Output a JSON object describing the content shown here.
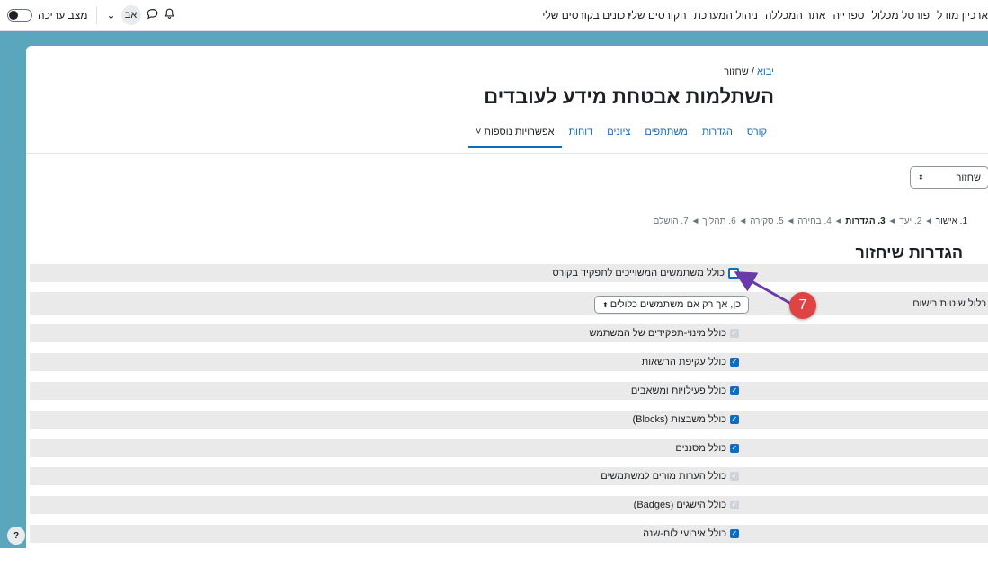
{
  "topbar": {
    "nav": [
      "רכונים בקורסים שלי",
      "הקורסים שלי",
      "ניהול המערכת",
      "אתר המכללה",
      "ספרייה",
      "פורטל מכלול",
      "ארכיון מודל"
    ],
    "edit_mode_label": "מצב עריכה",
    "user_initials": "אב"
  },
  "breadcrumb": {
    "home": "יבוא",
    "sep": "/",
    "current": "שחזור"
  },
  "page_title": "השתלמות אבטחת מידע לעובדים",
  "secondary_nav": [
    {
      "label": "קורס",
      "active": false
    },
    {
      "label": "הגדרות",
      "active": false
    },
    {
      "label": "משתתפים",
      "active": false
    },
    {
      "label": "ציונים",
      "active": false
    },
    {
      "label": "דוחות",
      "active": false
    },
    {
      "label": "אפשרויות נוספות ˅",
      "active": true
    }
  ],
  "restore_select": {
    "value": "שחזור"
  },
  "steps": {
    "s1": "1. אישור",
    "s2": "2. יעד",
    "s3": "3. הגדרות",
    "s4": "4. בחירה",
    "s5": "5. סקירה",
    "s6": "6. תהליך",
    "s7": "7. הושלם",
    "arrow": "◄"
  },
  "section_title": "הגדרות שיחזור",
  "enrol_methods": {
    "label": "כלול שיטות רישום",
    "value": "כן, אך רק אם משתמשים כלולים"
  },
  "settings": [
    {
      "label": "כולל משתמשים המשוייכים לתפקיד בקורס",
      "state": "empty",
      "shade": true
    },
    {
      "label": "כולל מינוי-תפקידים של המשתמש",
      "state": "disabled",
      "shade": true
    },
    {
      "label": "כולל עקיפת הרשאות",
      "state": "checked",
      "shade": true
    },
    {
      "label": "כולל פעילויות ומשאבים",
      "state": "checked",
      "shade": true
    },
    {
      "label": "כולל משבצות (Blocks)",
      "state": "checked",
      "shade": true
    },
    {
      "label": "כולל מסננים",
      "state": "checked",
      "shade": true
    },
    {
      "label": "כולל הערות מורים למשתמשים",
      "state": "disabled",
      "shade": true
    },
    {
      "label": "כולל הישגים (Badges)",
      "state": "disabled",
      "shade": true
    },
    {
      "label": "כולל אירועי לוח-שנה",
      "state": "checked",
      "shade": true
    }
  ],
  "annotation": {
    "number": "7",
    "color": "#e04343",
    "arrow_color": "#6a3aa8"
  },
  "help": "?",
  "colors": {
    "accent": "#0f6cbf",
    "background": "#5aa7bd"
  }
}
